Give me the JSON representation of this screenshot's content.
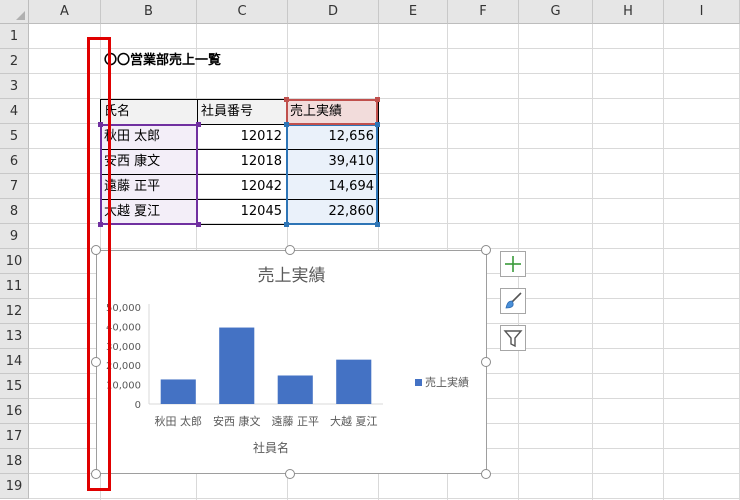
{
  "sheet": {
    "columns": [
      "A",
      "B",
      "C",
      "D",
      "E",
      "F",
      "G",
      "H",
      "I"
    ],
    "rows": [
      "1",
      "2",
      "3",
      "4",
      "5",
      "6",
      "7",
      "8",
      "9",
      "10",
      "11",
      "12",
      "13",
      "14",
      "15",
      "16",
      "17",
      "18",
      "19"
    ]
  },
  "title": "〇〇営業部売上一覧",
  "table": {
    "headers": [
      "氏名",
      "社員番号",
      "売上実績"
    ],
    "rows": [
      {
        "name": "秋田 太郎",
        "id": "12012",
        "sales": "12,656"
      },
      {
        "name": "安西 康文",
        "id": "12018",
        "sales": "39,410"
      },
      {
        "name": "遠藤 正平",
        "id": "12042",
        "sales": "14,694"
      },
      {
        "name": "大越 夏江",
        "id": "12045",
        "sales": "22,860"
      }
    ]
  },
  "chart_data": {
    "type": "bar",
    "title": "売上実績",
    "xlabel": "社員名",
    "ylabel": "",
    "categories": [
      "秋田 太郎",
      "安西 康文",
      "遠藤 正平",
      "大越 夏江"
    ],
    "series": [
      {
        "name": "売上実績",
        "values": [
          12656,
          39410,
          14694,
          22860
        ]
      }
    ],
    "ylim": [
      0,
      50000
    ],
    "yticks": [
      "0",
      "10,000",
      "20,000",
      "30,000",
      "40,000",
      "50,000"
    ],
    "legend": "right",
    "grid": false,
    "bar_color": "#4472c4"
  },
  "side_buttons": [
    {
      "icon": "plus-icon"
    },
    {
      "icon": "brush-icon"
    },
    {
      "icon": "filter-icon"
    }
  ],
  "colors": {
    "highlight_box": "#e00000",
    "range_purple": "#7030a0",
    "range_blue": "#2e75b6",
    "range_red": "#c0504d"
  }
}
